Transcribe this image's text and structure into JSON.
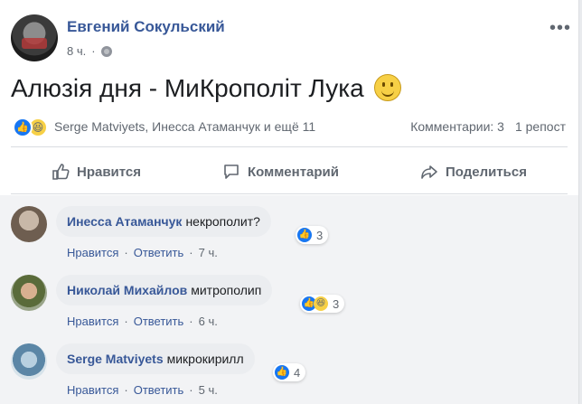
{
  "post": {
    "author": "Евгений Сокульский",
    "time": "8 ч.",
    "text": "Алюзія дня - МиКрополіт Лука",
    "more_icon": "more-horizontal-icon"
  },
  "reactions": {
    "names": "Serge Matviyets, Инесса Атаманчук и ещё 11",
    "comments_count": "Комментарии: 3",
    "shares": "1 репост"
  },
  "actions": {
    "like": "Нравится",
    "comment": "Комментарий",
    "share": "Поделиться"
  },
  "comments": [
    {
      "name": "Инесса Атаманчук",
      "text": "некрополит?",
      "reactions": "3",
      "like": "Нравится",
      "reply": "Ответить",
      "time": "7 ч."
    },
    {
      "name": "Николай Михайлов",
      "text": "митрополип",
      "reactions": "3",
      "like": "Нравится",
      "reply": "Ответить",
      "time": "6 ч."
    },
    {
      "name": "Serge Matviyets",
      "text": "микрокирилл",
      "reactions": "4",
      "like": "Нравится",
      "reply": "Ответить",
      "time": "5 ч."
    }
  ],
  "colors": {
    "link": "#385898",
    "like_blue": "#1877f2",
    "background": "#e9ebee"
  }
}
